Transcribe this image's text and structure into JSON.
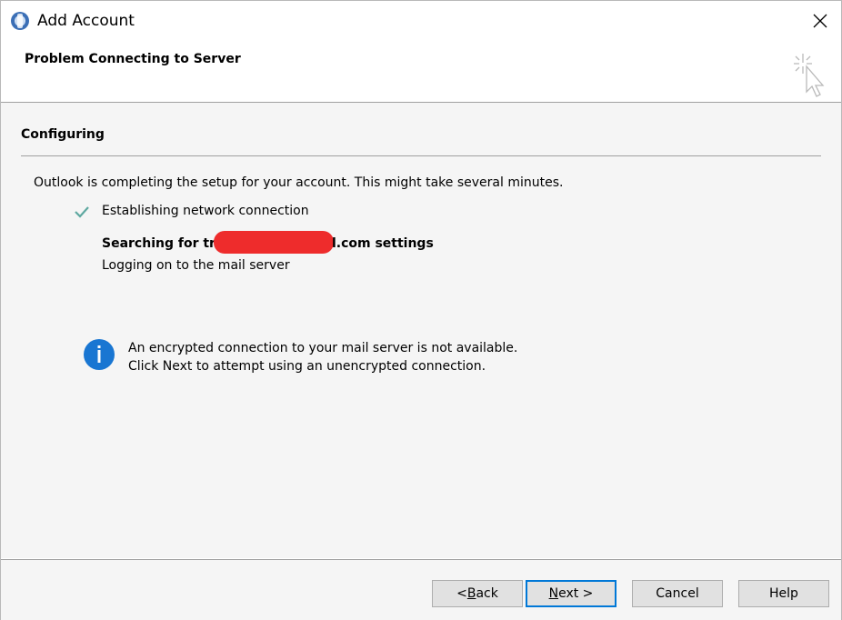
{
  "window": {
    "title": "Add Account"
  },
  "header": {
    "title": "Problem Connecting to Server"
  },
  "section": {
    "title": "Configuring"
  },
  "intro": "Outlook is completing the setup for your account. This might take several minutes.",
  "steps": [
    {
      "label": "Establishing network connection",
      "status": "done"
    },
    {
      "label_prefix": "Searching for tr",
      "label_suffix": "l.com settings",
      "status": "in-progress"
    },
    {
      "label": "Logging on to the mail server",
      "status": "pending"
    }
  ],
  "info": {
    "line1": "An encrypted connection to your mail server is not available.",
    "line2": "Click Next to attempt using an unencrypted connection."
  },
  "buttons": {
    "back_prefix": "< ",
    "back_mnemonic": "B",
    "back_rest": "ack",
    "next_mnemonic": "N",
    "next_rest": "ext >",
    "cancel": "Cancel",
    "help": "Help"
  },
  "colors": {
    "check": "#5ea8a0",
    "info": "#1976d2",
    "redaction": "#ee2c2c",
    "default_button_border": "#0078d7"
  }
}
